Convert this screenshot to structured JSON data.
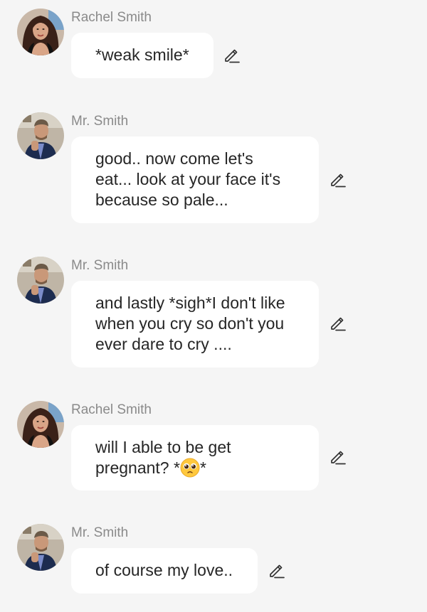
{
  "messages": [
    {
      "sender": "Rachel Smith",
      "avatar": "woman-avatar",
      "lines": [
        "*weak smile*"
      ]
    },
    {
      "sender": "Mr. Smith",
      "avatar": "man-avatar",
      "lines": [
        "good.. now come let's",
        "eat... look at your face  it's",
        "because so pale..."
      ]
    },
    {
      "sender": "Mr. Smith",
      "avatar": "man-avatar",
      "lines": [
        "and lastly *sigh*I don't like",
        "when you cry so don't you",
        "ever dare to cry ...."
      ]
    },
    {
      "sender": "Rachel Smith",
      "avatar": "woman-avatar",
      "lines": [
        "will I able to be get",
        "pregnant? *",
        "*"
      ]
    },
    {
      "sender": "Mr. Smith",
      "avatar": "man-avatar",
      "lines": [
        "of course my love.."
      ]
    }
  ],
  "icons": {
    "edit": "pencil-edit-icon",
    "emoji": "pleading-face-emoji"
  },
  "colors": {
    "background": "#f5f5f5",
    "bubble": "#ffffff",
    "sender_name": "#8a8a8a",
    "text": "#262626"
  }
}
